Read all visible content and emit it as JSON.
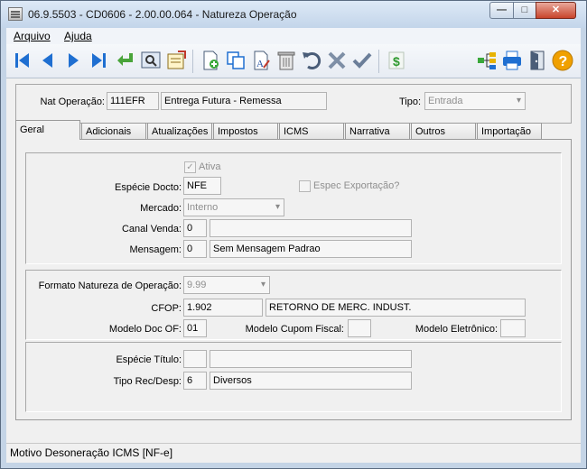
{
  "window": {
    "title": "06.9.5503 - CD0606 - 2.00.00.064 - Natureza Operação",
    "buttons": {
      "minimize": "—",
      "maximize": "□",
      "close": "✕"
    }
  },
  "menu": {
    "arquivo": "Arquivo",
    "ajuda": "Ajuda"
  },
  "toolbar": {
    "icons": [
      "first-icon",
      "prev-icon",
      "next-icon",
      "last-icon",
      "goto-icon",
      "search-icon",
      "list-icon",
      "new-icon",
      "copy-icon",
      "edit-icon",
      "delete-icon",
      "undo-icon",
      "cancel-icon",
      "save-icon",
      "dollar-icon",
      "tree-icon",
      "print-icon",
      "exit-icon",
      "help-icon"
    ],
    "help_glyph": "?",
    "dollar_glyph": "$"
  },
  "header": {
    "nat_label": "Nat Operação:",
    "nat_code": "111EFR",
    "nat_desc": "Entrega Futura - Remessa",
    "tipo_label": "Tipo:",
    "tipo_value": "Entrada"
  },
  "tabs": [
    "Geral",
    "Adicionais",
    "Atualizações",
    "Impostos",
    "ICMS",
    "Narrativa",
    "Outros",
    "Importação"
  ],
  "geral": {
    "ativa_label": "Ativa",
    "ativa_mark": "✓",
    "especie_label": "Espécie Docto:",
    "especie_value": "NFE",
    "espec_exp_label": "Espec Exportação?",
    "mercado_label": "Mercado:",
    "mercado_value": "Interno",
    "canal_label": "Canal Venda:",
    "canal_code": "0",
    "canal_desc": "",
    "mensagem_label": "Mensagem:",
    "mensagem_code": "0",
    "mensagem_desc": "Sem Mensagem Padrao",
    "formato_label": "Formato Natureza de Operação:",
    "formato_value": "9.99",
    "cfop_label": "CFOP:",
    "cfop_code": "1.902",
    "cfop_desc": "RETORNO DE MERC. INDUST.",
    "modelo_of_label": "Modelo Doc OF:",
    "modelo_of_value": "01",
    "modelo_cupom_label": "Modelo Cupom Fiscal:",
    "modelo_cupom_value": "",
    "modelo_elet_label": "Modelo Eletrônico:",
    "modelo_elet_value": "",
    "especie_titulo_label": "Espécie Título:",
    "especie_titulo_code": "",
    "especie_titulo_desc": "",
    "tipo_rec_label": "Tipo Rec/Desp:",
    "tipo_rec_code": "6",
    "tipo_rec_desc": "Diversos"
  },
  "status": {
    "text": "Motivo Desoneração ICMS [NF-e]"
  },
  "colors": {
    "accent": "#1f6fd1",
    "green": "#2f9a2f",
    "help": "#f0a000"
  }
}
